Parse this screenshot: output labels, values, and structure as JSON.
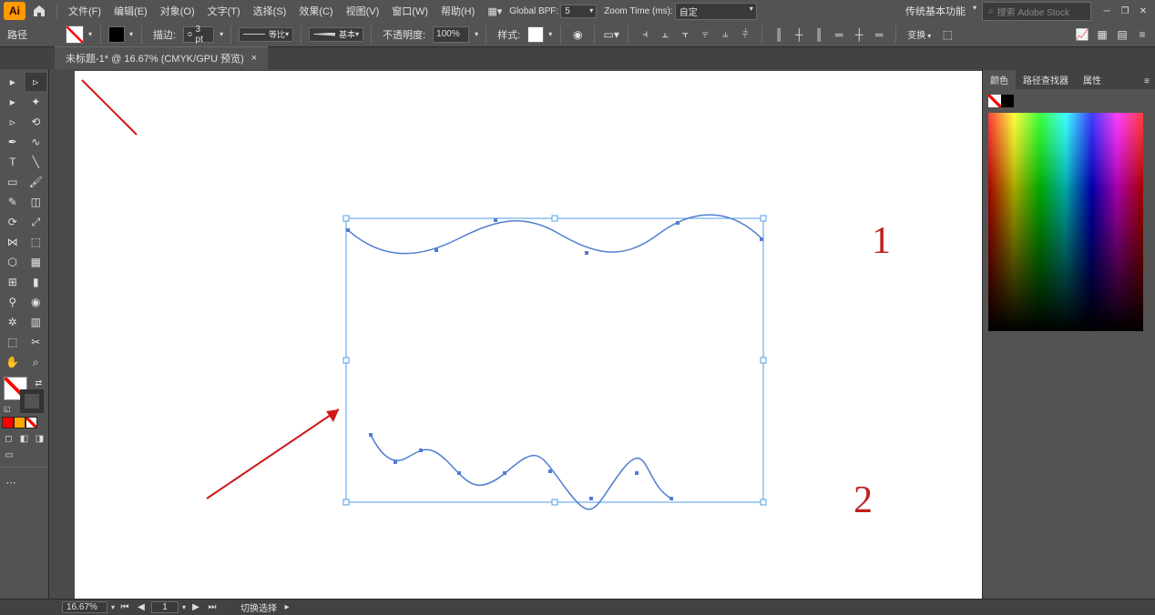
{
  "app": {
    "logo": "Ai",
    "workspace": "传统基本功能",
    "search_placeholder": "搜索 Adobe Stock"
  },
  "menus": {
    "file": "文件(F)",
    "edit": "编辑(E)",
    "object": "对象(O)",
    "type": "文字(T)",
    "select": "选择(S)",
    "effect": "效果(C)",
    "view": "视图(V)",
    "window": "窗口(W)",
    "help": "帮助(H)"
  },
  "menubar_extra": {
    "global_bpf_label": "Global BPF:",
    "global_bpf_value": "5",
    "zoom_time_label": "Zoom Time (ms):",
    "zoom_time_value": "自定"
  },
  "optbar": {
    "path_label": "路径",
    "stroke_label": "描边:",
    "stroke_value": "3 pt",
    "stroke_style_label": "等比",
    "brush_label": "基本",
    "opacity_label": "不透明度:",
    "opacity_value": "100%",
    "style_label": "样式:",
    "transform_label": "变换"
  },
  "tab": {
    "title": "未标题-1* @ 16.67% (CMYK/GPU 预览)"
  },
  "panels": {
    "color_tab": "颜色",
    "pathfinder_tab": "路径查找器",
    "properties_tab": "属性"
  },
  "status": {
    "zoom": "16.67%",
    "artboard": "1",
    "tool": "切换选择"
  },
  "canvas_annotations": {
    "mark1": "1",
    "mark2": "2"
  }
}
